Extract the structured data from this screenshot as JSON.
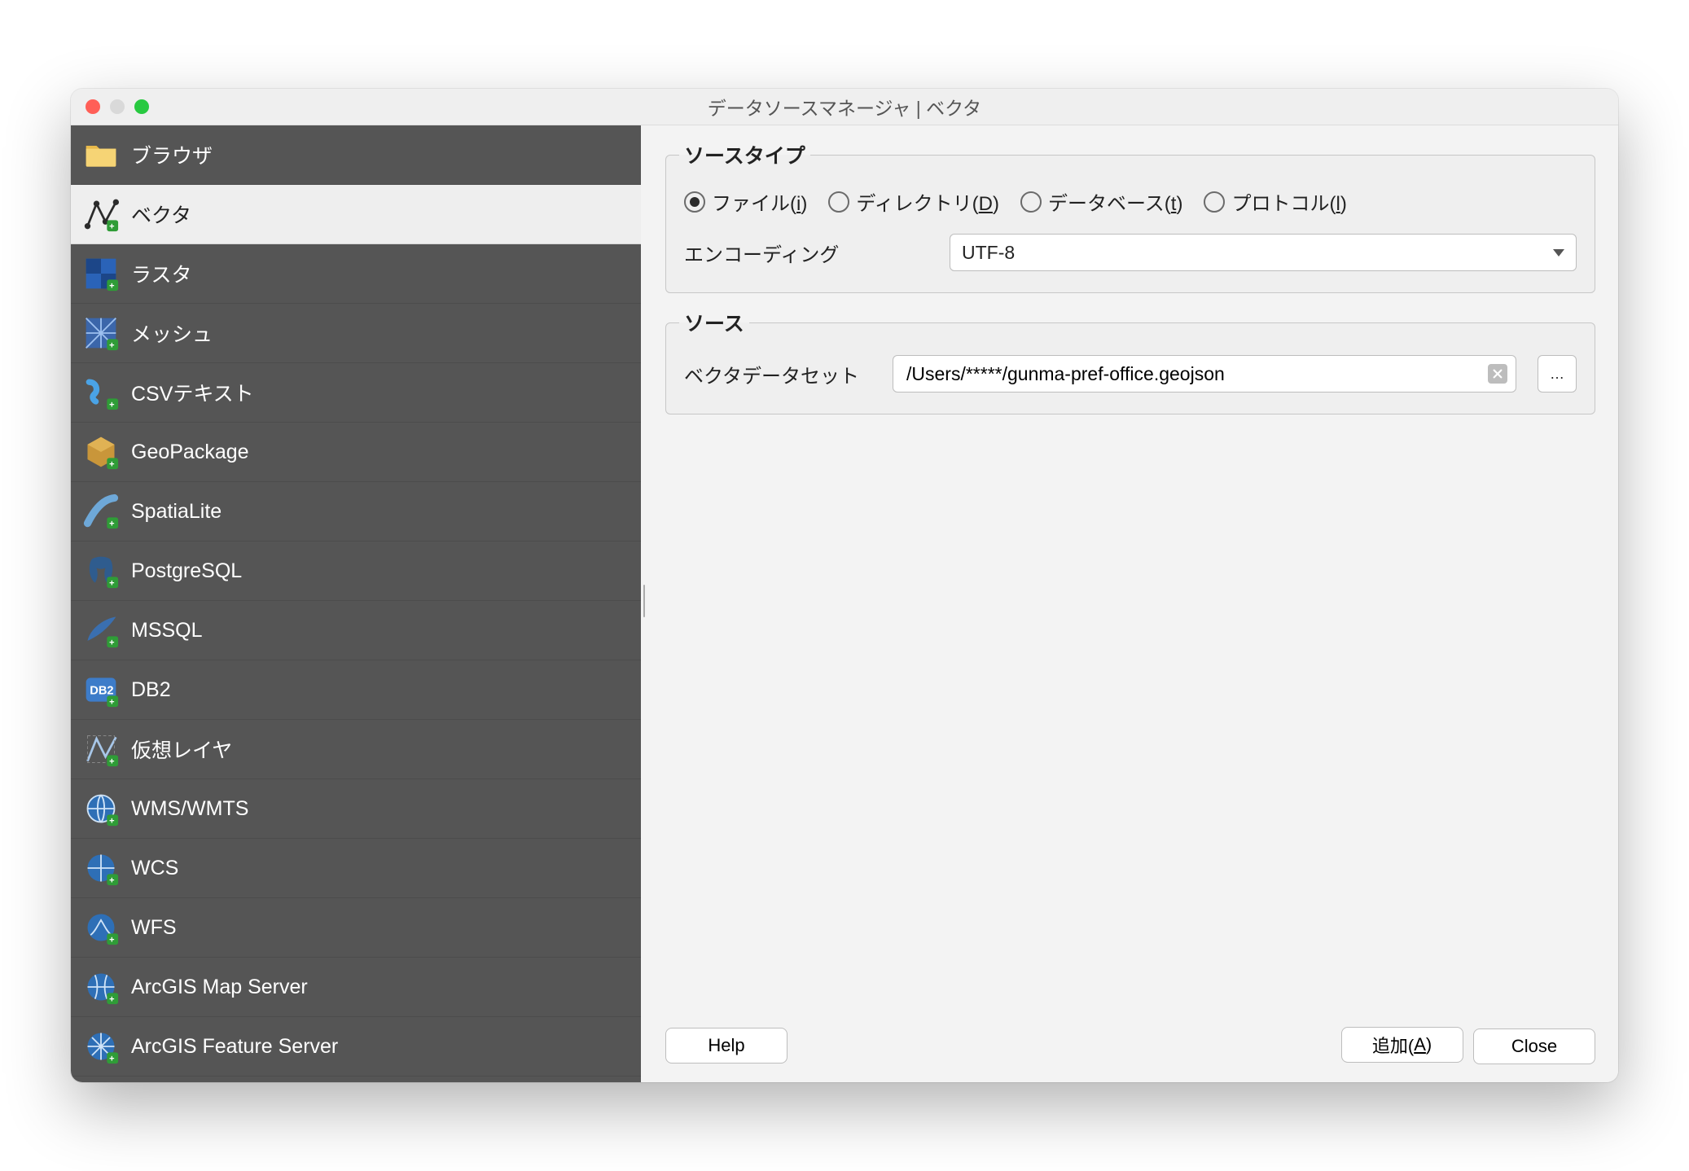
{
  "window": {
    "title": "データソースマネージャ | ベクタ"
  },
  "sidebar": {
    "items": [
      {
        "label": "ブラウザ"
      },
      {
        "label": "ベクタ"
      },
      {
        "label": "ラスタ"
      },
      {
        "label": "メッシュ"
      },
      {
        "label": "CSVテキスト"
      },
      {
        "label": "GeoPackage"
      },
      {
        "label": "SpatiaLite"
      },
      {
        "label": "PostgreSQL"
      },
      {
        "label": "MSSQL"
      },
      {
        "label": "DB2"
      },
      {
        "label": "仮想レイヤ"
      },
      {
        "label": "WMS/WMTS"
      },
      {
        "label": "WCS"
      },
      {
        "label": "WFS"
      },
      {
        "label": "ArcGIS Map Server"
      },
      {
        "label": "ArcGIS Feature Server"
      }
    ],
    "selected_index": 1
  },
  "source_type": {
    "legend": "ソースタイプ",
    "options": {
      "file": {
        "label": "ファイル(i)",
        "key": "i",
        "checked": true
      },
      "directory": {
        "label": "ディレクトリ(D)",
        "key": "D",
        "checked": false
      },
      "database": {
        "label": "データベース(t)",
        "key": "t",
        "checked": false
      },
      "protocol": {
        "label": "プロトコル(l)",
        "key": "l",
        "checked": false
      }
    },
    "encoding_label": "エンコーディング",
    "encoding_value": "UTF-8"
  },
  "source": {
    "legend": "ソース",
    "dataset_label": "ベクタデータセット",
    "dataset_value": "/Users/*****/gunma-pref-office.geojson",
    "browse_label": "…"
  },
  "footer": {
    "help": "Help",
    "add": "追加(A)",
    "close": "Close"
  }
}
